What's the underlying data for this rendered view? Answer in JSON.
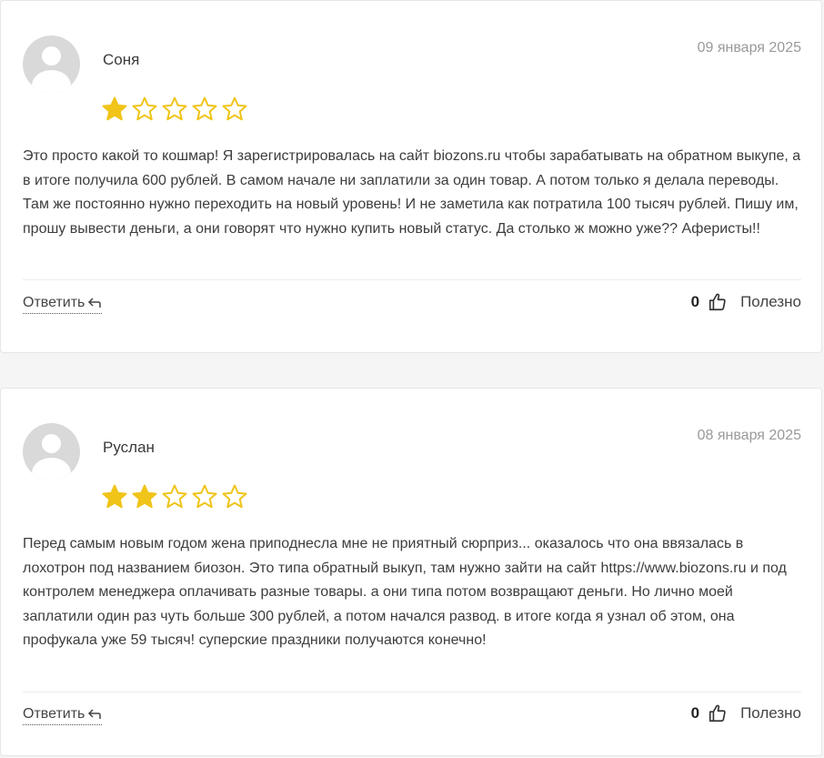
{
  "colors": {
    "star_filled": "#f0c419",
    "star_empty_outline": "#f0c419",
    "avatar_bg": "#d9d9d9"
  },
  "reviews": [
    {
      "author": "Соня",
      "date": "09 января 2025",
      "rating": 1,
      "max_rating": 5,
      "text": "Это просто какой то кошмар! Я зарегистрировалась на сайт biozons.ru чтобы зарабатывать на обратном выкупе, а в итоге получила 600 рублей. В самом начале ни заплатили за один товар. А потом только я делала переводы. Там же постоянно нужно переходить на новый уровень! И не заметила как потратила 100 тысяч рублей. Пишу им, прошу вывести деньги, а они говорят что нужно купить новый статус. Да столько ж можно уже?? Аферисты!!",
      "reply_label": "Ответить",
      "helpful_count": "0",
      "helpful_label": "Полезно"
    },
    {
      "author": "Руслан",
      "date": "08 января 2025",
      "rating": 2,
      "max_rating": 5,
      "text": "Перед самым новым годом жена приподнесла мне не приятный сюрприз... оказалось что она ввязалась в лохотрон под названием биозон. Это типа обратный выкуп, там нужно зайти на сайт https://www.biozons.ru и под контролем менеджера оплачивать разные товары. а они типа потом возвращают деньги. Но лично моей заплатили один раз чуть больше 300 рублей, а потом начался развод. в итоге когда я узнал об этом, она профукала уже 59 тысяч! суперские праздники получаются конечно!",
      "reply_label": "Ответить",
      "helpful_count": "0",
      "helpful_label": "Полезно"
    }
  ]
}
